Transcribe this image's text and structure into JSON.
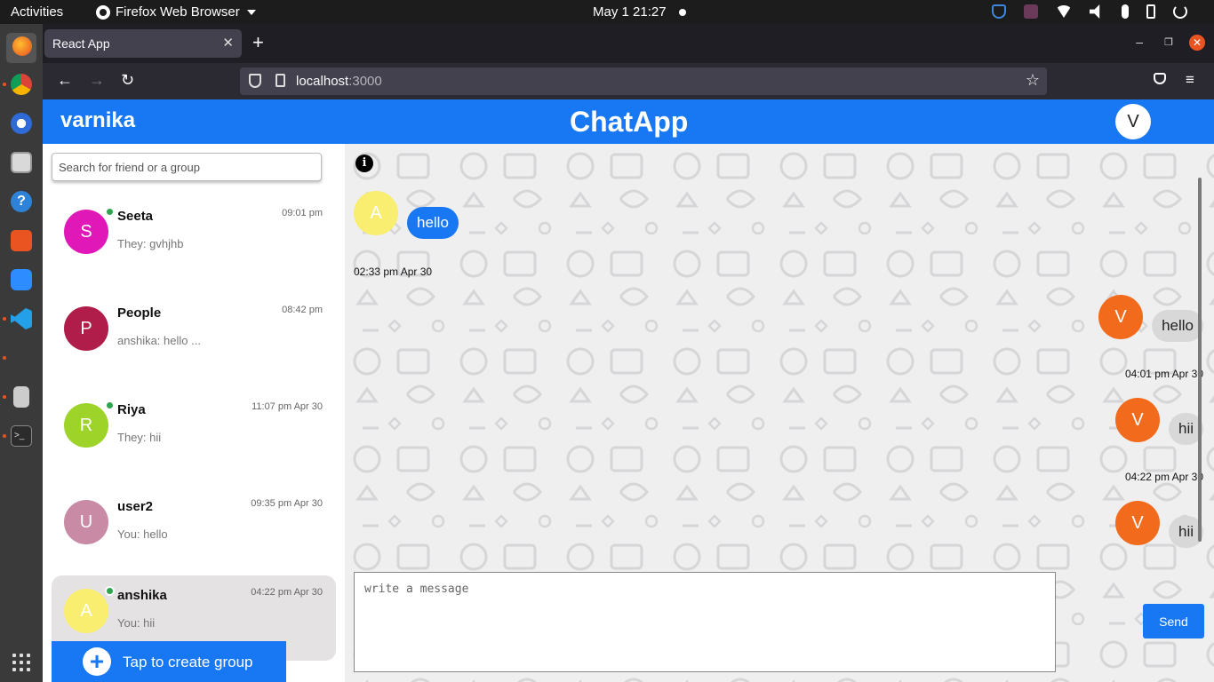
{
  "system": {
    "activities": "Activities",
    "app_menu": "Firefox Web Browser",
    "clock": "May 1  21:27"
  },
  "browser": {
    "tab_title": "React App",
    "url_host": "localhost",
    "url_port": ":3000"
  },
  "app": {
    "username": "varnika",
    "brand": "ChatApp",
    "avatar_letter": "V",
    "search_placeholder": "Search for friend or a group",
    "chats": [
      {
        "initial": "S",
        "name": "Seeta",
        "last": "They: gvhjhb",
        "time": "09:01 pm",
        "online": true,
        "color": "#e018b8",
        "active": false
      },
      {
        "initial": "P",
        "name": "People",
        "last": "anshika: hello ...",
        "time": "08:42 pm",
        "online": false,
        "color": "#b01d4a",
        "active": false
      },
      {
        "initial": "R",
        "name": "Riya",
        "last": "They: hii",
        "time": "11:07 pm Apr 30",
        "online": true,
        "color": "#9ed42a",
        "active": false
      },
      {
        "initial": "U",
        "name": "user2",
        "last": "You: hello",
        "time": "09:35 pm Apr 30",
        "online": false,
        "color": "#c98aa5",
        "active": false
      },
      {
        "initial": "A",
        "name": "anshika",
        "last": "You: hii",
        "time": "04:22 pm Apr 30",
        "online": true,
        "color": "#f9ee6f",
        "active": true
      }
    ],
    "create_group": "Tap to create group",
    "messages": [
      {
        "dir": "in",
        "avatar": "A",
        "avatar_color": "#f9ee6f",
        "text": "hello",
        "time": "02:33 pm Apr 30"
      },
      {
        "dir": "out",
        "avatar": "V",
        "avatar_color": "#f26b1d",
        "text": "hello",
        "time": "04:01 pm Apr 30"
      },
      {
        "dir": "out",
        "avatar": "V",
        "avatar_color": "#f26b1d",
        "text": "hii",
        "time": "04:22 pm Apr 30"
      },
      {
        "dir": "out",
        "avatar": "V",
        "avatar_color": "#f26b1d",
        "text": "hii",
        "time": ""
      }
    ],
    "composer_placeholder": "write a message",
    "send_label": "Send",
    "colors": {
      "primary": "#1877f2",
      "online": "#2ea44f"
    }
  }
}
